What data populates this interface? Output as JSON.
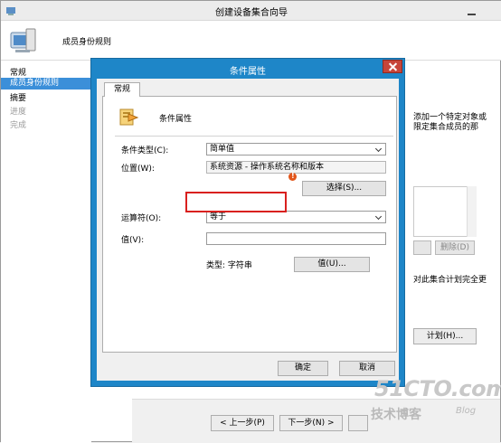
{
  "wizard": {
    "title": "创建设备集合向导",
    "header_title": "成员身份规则",
    "nav": [
      {
        "label": "常规",
        "state": "normal"
      },
      {
        "label": "成员身份规则",
        "state": "active"
      },
      {
        "label": "摘要",
        "state": "normal"
      },
      {
        "label": "进度",
        "state": "disabled"
      },
      {
        "label": "完成",
        "state": "disabled"
      }
    ],
    "content_fragment_line1": "添加一个特定对象或",
    "content_fragment_line2": "限定集合成员的那",
    "remove_label": "删除(D)",
    "schedule_text": "对此集合计划完全更",
    "schedule_button": "计划(H)...",
    "back_button": "< 上一步(P)",
    "next_button": "下一步(N) >"
  },
  "dialog": {
    "title": "条件属性",
    "tab": "常规",
    "heading": "条件属性",
    "condition_type_label": "条件类型(C):",
    "condition_type_value": "简单值",
    "location_label": "位置(W):",
    "location_value": "系统资源 - 操作系统名称和版本",
    "select_button": "选择(S)...",
    "operator_label": "运算符(O):",
    "operator_value": "等于",
    "value_label": "值(V):",
    "value_value": "",
    "type_text": "类型: 字符串",
    "value_button": "值(U)...",
    "ok_button": "确定",
    "cancel_button": "取消"
  },
  "watermark": {
    "logo": "51CTO.com",
    "sub": "技术博客",
    "blog": "Blog"
  },
  "colors": {
    "dialog_frame": "#1e86c8",
    "nav_active": "#3b8fd9",
    "highlight": "#d9201e",
    "close_button": "#c7453a"
  }
}
